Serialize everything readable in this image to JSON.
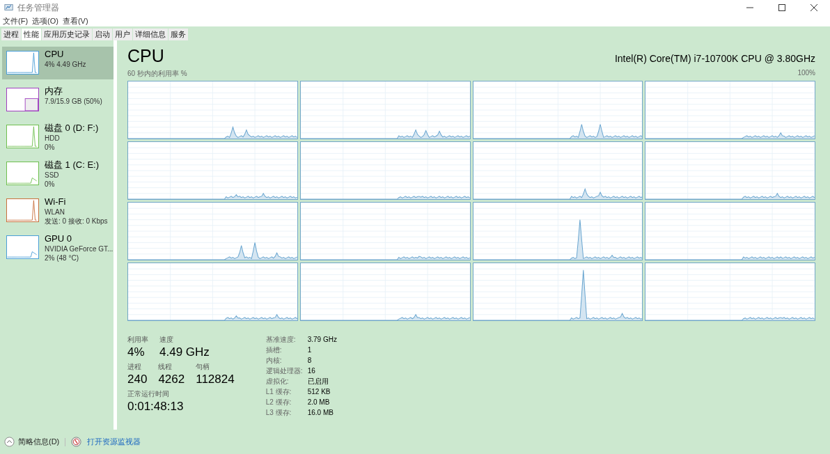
{
  "window": {
    "title": "任务管理器"
  },
  "menu": [
    "文件(F)",
    "选项(O)",
    "查看(V)"
  ],
  "tabs": [
    {
      "label": "进程",
      "selected": false
    },
    {
      "label": "性能",
      "selected": true
    },
    {
      "label": "应用历史记录",
      "selected": false
    },
    {
      "label": "启动",
      "selected": false
    },
    {
      "label": "用户",
      "selected": false
    },
    {
      "label": "详细信息",
      "selected": false
    },
    {
      "label": "服务",
      "selected": false
    }
  ],
  "sidebar": {
    "items": [
      {
        "name": "CPU",
        "lines": [
          "4%  4.49 GHz"
        ],
        "selected": true,
        "color": "#4a9fd8",
        "kind": "line"
      },
      {
        "name": "内存",
        "lines": [
          "7.9/15.9 GB (50%)"
        ],
        "selected": false,
        "color": "#a040c0",
        "kind": "composition"
      },
      {
        "name": "磁盘 0 (D: F:)",
        "lines": [
          "HDD",
          "0%"
        ],
        "selected": false,
        "color": "#6fbf4f",
        "kind": "line"
      },
      {
        "name": "磁盘 1 (C: E:)",
        "lines": [
          "SSD",
          "0%"
        ],
        "selected": false,
        "color": "#6fbf4f",
        "kind": "line"
      },
      {
        "name": "Wi-Fi",
        "lines": [
          "WLAN",
          "发送: 0 接收: 0 Kbps"
        ],
        "selected": false,
        "color": "#c8703c",
        "kind": "line"
      },
      {
        "name": "GPU 0",
        "lines": [
          "NVIDIA GeForce GT...",
          "2%  (48 °C)"
        ],
        "selected": false,
        "color": "#4a9fd8",
        "kind": "line"
      }
    ]
  },
  "main": {
    "title": "CPU",
    "model": "Intel(R) Core(TM) i7-10700K CPU @ 3.80GHz",
    "chart_label": "60 秒内的利用率 %",
    "chart_max": "100%",
    "stat_rows": [
      [
        {
          "label": "利用率",
          "value": "4%"
        },
        {
          "label": "速度",
          "value": "4.49 GHz"
        }
      ],
      [
        {
          "label": "进程",
          "value": "240"
        },
        {
          "label": "线程",
          "value": "4262"
        },
        {
          "label": "句柄",
          "value": "112824"
        }
      ],
      [
        {
          "label": "正常运行时间",
          "value": "0:01:48:13"
        }
      ]
    ],
    "specs": [
      {
        "label": "基准速度:",
        "value": "3.79 GHz"
      },
      {
        "label": "插槽:",
        "value": "1"
      },
      {
        "label": "内核:",
        "value": "8"
      },
      {
        "label": "逻辑处理器:",
        "value": "16"
      },
      {
        "label": "虚拟化:",
        "value": "已启用"
      },
      {
        "label": "L1 缓存:",
        "value": "512 KB"
      },
      {
        "label": "L2 缓存:",
        "value": "2.0 MB"
      },
      {
        "label": "L3 缓存:",
        "value": "16.0 MB"
      }
    ]
  },
  "footer": {
    "details": "简略信息(D)",
    "monitor": "打开资源监视器"
  }
}
